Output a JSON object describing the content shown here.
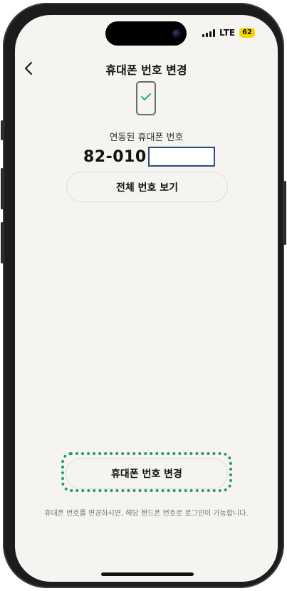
{
  "status": {
    "network": "LTE",
    "battery": "62"
  },
  "header": {
    "title": "휴대폰 번호 변경"
  },
  "linked": {
    "label": "연동된 휴대폰 번호",
    "number_prefix": "82-010"
  },
  "buttons": {
    "show_all": "전체 번호 보기",
    "change": "휴대폰 번호 변경"
  },
  "notice": "휴대폰 번호를 변경하시면, 해당 핸드폰 번호로 로그인이 가능합니다.",
  "colors": {
    "background": "#f6f4f1",
    "check": "#1fb37a",
    "highlight": "#1f9d5a",
    "battery": "#f5d400"
  },
  "icons": {
    "back": "chevron-left-icon",
    "phone": "phone-check-icon"
  }
}
